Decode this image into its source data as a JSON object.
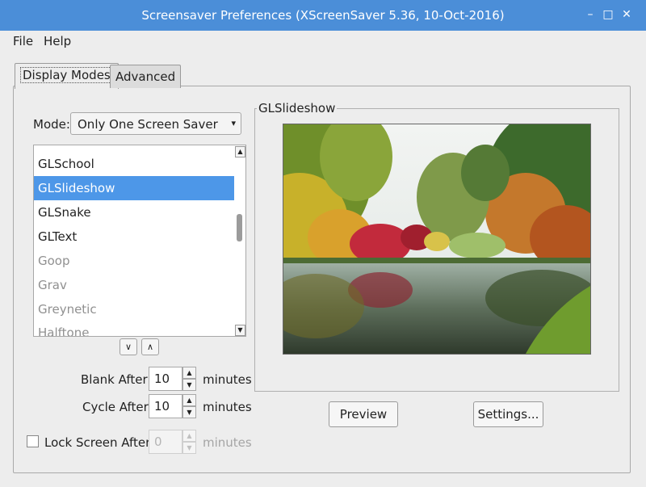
{
  "window": {
    "title": "Screensaver Preferences  (XScreenSaver 5.36, 10-Oct-2016)",
    "controls": {
      "minimize": "–",
      "maximize": "□",
      "close": "✕"
    }
  },
  "menu": [
    "File",
    "Help"
  ],
  "tabs": [
    {
      "label": "Display Modes",
      "active": true
    },
    {
      "label": "Advanced",
      "active": false
    }
  ],
  "mode": {
    "label": "Mode:",
    "value": "Only One Screen Saver"
  },
  "screensavers": [
    {
      "name": "GLSchool",
      "state": "normal"
    },
    {
      "name": "GLSlideshow",
      "state": "selected"
    },
    {
      "name": "GLSnake",
      "state": "normal"
    },
    {
      "name": "GLText",
      "state": "normal"
    },
    {
      "name": "Goop",
      "state": "dim"
    },
    {
      "name": "Grav",
      "state": "dim"
    },
    {
      "name": "Greynetic",
      "state": "dim"
    },
    {
      "name": "Halftone",
      "state": "dim"
    }
  ],
  "timing": {
    "blank_label": "Blank After",
    "blank_value": "10",
    "blank_unit": "minutes",
    "cycle_label": "Cycle After",
    "cycle_value": "10",
    "cycle_unit": "minutes",
    "lock_label": "Lock Screen After",
    "lock_value": "0",
    "lock_unit": "minutes",
    "lock_checked": false
  },
  "preview": {
    "frame_title": "GLSlideshow"
  },
  "buttons": {
    "preview": "Preview",
    "settings": "Settings..."
  },
  "colors": {
    "titlebar": "#4b8ed8",
    "selection": "#4d97e8"
  }
}
